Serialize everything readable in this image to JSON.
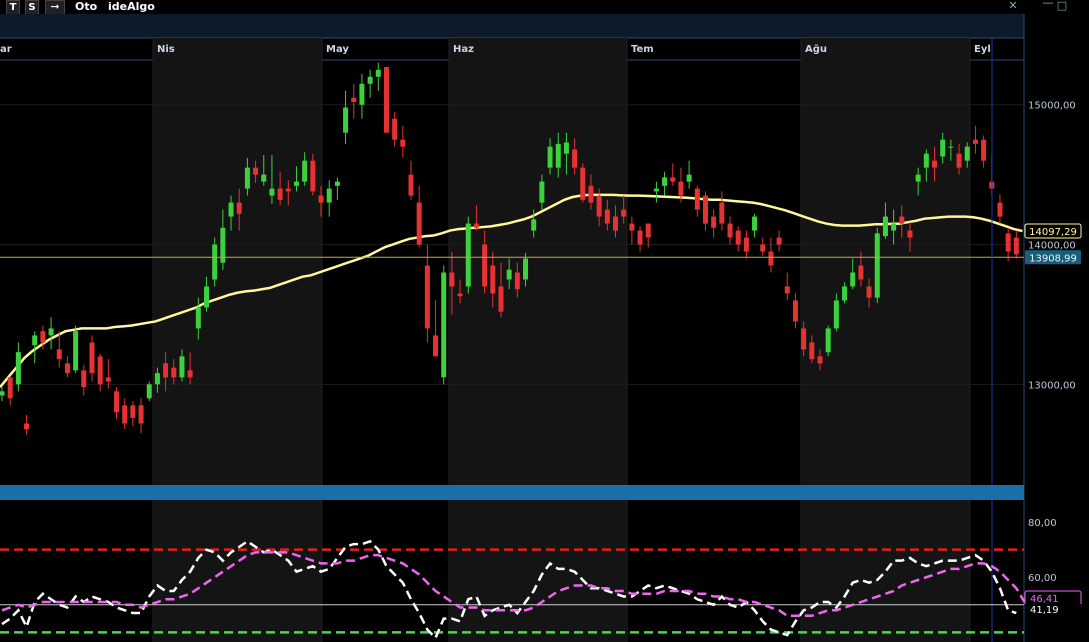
{
  "toolbar": {
    "btn_t": "T",
    "btn_s": "S",
    "arrow_icon": "arrow-right-icon",
    "oto": "Oto",
    "idealgo": "ideAlgo"
  },
  "window_controls": {
    "close": "✕",
    "minimize": "—",
    "maximize": "□"
  },
  "colors": {
    "up": "#3ed13e",
    "down": "#e63232",
    "ma": "#fff79a",
    "rsi": "#ffffff",
    "signal": "#ee66ee",
    "level_high": "#e02020",
    "level_low": "#44dd44",
    "separator": "#1a6fa8",
    "price_line": "#c8a64a",
    "label_ma_bg": "#000000",
    "label_price_bg": "#1a5f7a"
  },
  "chart_data": {
    "type": "candlestick",
    "months": [
      "ar",
      "Nis",
      "May",
      "Haz",
      "Tem",
      "Ağu",
      "Eyl"
    ],
    "y_ticks": [
      "15000,00",
      "14000,00",
      "13000,00"
    ],
    "y_values": [
      15000,
      14000,
      13000
    ],
    "price_range": [
      12280,
      15320
    ],
    "ma_label": "14097,29",
    "ma_value": 14097.29,
    "price_label": "13908,99",
    "price_value": 13908.99,
    "indicator": {
      "range": [
        36.5,
        88
      ],
      "ticks": [
        "80,00",
        "60,00"
      ],
      "tick_values": [
        80,
        60
      ],
      "level_high": 70,
      "level_low": 40,
      "mid_level": 50,
      "last_rsi_label": "41,19",
      "last_signal_label": "46,41"
    },
    "candles": [
      [
        12920,
        12980,
        12880,
        12950
      ],
      [
        13050,
        13030,
        12850,
        12900
      ],
      [
        13000,
        13300,
        12950,
        13230
      ],
      [
        12720,
        12780,
        12640,
        12680
      ],
      [
        13280,
        13380,
        13150,
        13350
      ],
      [
        13380,
        13420,
        13250,
        13300
      ],
      [
        13350,
        13480,
        13250,
        13400
      ],
      [
        13250,
        13380,
        13120,
        13180
      ],
      [
        13150,
        13200,
        13050,
        13080
      ],
      [
        13100,
        13420,
        13080,
        13380
      ],
      [
        13100,
        13140,
        12920,
        12980
      ],
      [
        13300,
        13350,
        13020,
        13080
      ],
      [
        13200,
        13220,
        12950,
        13000
      ],
      [
        13050,
        13180,
        12970,
        13020
      ],
      [
        12950,
        12980,
        12750,
        12800
      ],
      [
        12850,
        12900,
        12680,
        12720
      ],
      [
        12850,
        12880,
        12700,
        12760
      ],
      [
        12850,
        12900,
        12650,
        12720
      ],
      [
        12900,
        13020,
        12880,
        13000
      ],
      [
        13000,
        13120,
        12940,
        13080
      ],
      [
        13150,
        13230,
        12950,
        13050
      ],
      [
        13120,
        13180,
        13000,
        13050
      ],
      [
        13050,
        13250,
        13020,
        13200
      ],
      [
        13100,
        13230,
        13000,
        13050
      ],
      [
        13400,
        13620,
        13320,
        13550
      ],
      [
        13550,
        13770,
        13520,
        13700
      ],
      [
        13750,
        14050,
        13700,
        14000
      ],
      [
        13870,
        14250,
        13820,
        14120
      ],
      [
        14200,
        14350,
        14100,
        14300
      ],
      [
        14300,
        14400,
        14100,
        14220
      ],
      [
        14400,
        14620,
        14350,
        14550
      ],
      [
        14550,
        14600,
        14440,
        14500
      ],
      [
        14450,
        14640,
        14420,
        14500
      ],
      [
        14350,
        14640,
        14290,
        14400
      ],
      [
        14400,
        14520,
        14280,
        14320
      ],
      [
        14400,
        14460,
        14280,
        14380
      ],
      [
        14420,
        14560,
        14380,
        14450
      ],
      [
        14450,
        14660,
        14420,
        14600
      ],
      [
        14600,
        14650,
        14350,
        14380
      ],
      [
        14350,
        14420,
        14200,
        14300
      ],
      [
        14300,
        14460,
        14200,
        14400
      ],
      [
        14420,
        14480,
        14320,
        14450
      ],
      [
        14800,
        15100,
        14720,
        14980
      ],
      [
        15050,
        15150,
        14900,
        15020
      ],
      [
        15000,
        15220,
        14900,
        15150
      ],
      [
        15150,
        15250,
        15050,
        15200
      ],
      [
        15200,
        15300,
        15100,
        15250
      ],
      [
        15270,
        15200,
        14950,
        14800
      ],
      [
        14900,
        14950,
        14700,
        14750
      ],
      [
        14750,
        14850,
        14620,
        14700
      ],
      [
        14500,
        14600,
        14320,
        14350
      ],
      [
        14300,
        14420,
        13980,
        14000
      ],
      [
        13850,
        14000,
        13300,
        13400
      ],
      [
        13350,
        13600,
        13200,
        13200
      ],
      [
        13050,
        13850,
        13000,
        13800
      ],
      [
        13800,
        13950,
        13500,
        13700
      ],
      [
        13650,
        13750,
        13580,
        13630
      ],
      [
        13700,
        14200,
        13650,
        14150
      ],
      [
        14150,
        14280,
        14100,
        14120
      ],
      [
        14000,
        14100,
        13650,
        13700
      ],
      [
        13850,
        13950,
        13550,
        13650
      ],
      [
        13700,
        13870,
        13480,
        13520
      ],
      [
        13750,
        13900,
        13680,
        13820
      ],
      [
        13800,
        13870,
        13620,
        13680
      ],
      [
        13750,
        13940,
        13700,
        13900
      ],
      [
        14100,
        14250,
        14050,
        14180
      ],
      [
        14300,
        14500,
        14250,
        14450
      ],
      [
        14550,
        14760,
        14500,
        14700
      ],
      [
        14550,
        14800,
        14480,
        14720
      ],
      [
        14650,
        14800,
        14500,
        14730
      ],
      [
        14680,
        14760,
        14500,
        14550
      ],
      [
        14550,
        14580,
        14300,
        14320
      ],
      [
        14420,
        14500,
        14250,
        14300
      ],
      [
        14350,
        14400,
        14130,
        14200
      ],
      [
        14250,
        14320,
        14100,
        14150
      ],
      [
        14200,
        14280,
        14050,
        14100
      ],
      [
        14250,
        14350,
        14150,
        14200
      ],
      [
        14150,
        14200,
        14000,
        14100
      ],
      [
        14100,
        14130,
        13950,
        14000
      ],
      [
        14150,
        14150,
        13980,
        14050
      ],
      [
        14380,
        14450,
        14300,
        14400
      ],
      [
        14420,
        14520,
        14350,
        14480
      ],
      [
        14480,
        14580,
        14420,
        14450
      ],
      [
        14450,
        14550,
        14300,
        14350
      ],
      [
        14450,
        14600,
        14400,
        14500
      ],
      [
        14400,
        14420,
        14200,
        14250
      ],
      [
        14350,
        14380,
        14100,
        14150
      ],
      [
        14200,
        14250,
        14050,
        14120
      ],
      [
        14300,
        14380,
        14100,
        14150
      ],
      [
        14150,
        14200,
        14000,
        14050
      ],
      [
        14100,
        14130,
        13950,
        14000
      ],
      [
        14050,
        14100,
        13900,
        13950
      ],
      [
        14100,
        14220,
        14050,
        14200
      ],
      [
        14000,
        14050,
        13920,
        13950
      ],
      [
        13950,
        14050,
        13800,
        13850
      ],
      [
        14050,
        14100,
        13950,
        14000
      ],
      [
        13700,
        13800,
        13600,
        13650
      ],
      [
        13600,
        13650,
        13400,
        13450
      ],
      [
        13400,
        13450,
        13200,
        13250
      ],
      [
        13300,
        13350,
        13150,
        13180
      ],
      [
        13200,
        13250,
        13100,
        13150
      ],
      [
        13230,
        13420,
        13200,
        13400
      ],
      [
        13400,
        13650,
        13380,
        13600
      ],
      [
        13600,
        13730,
        13580,
        13700
      ],
      [
        13700,
        13900,
        13680,
        13800
      ],
      [
        13850,
        13950,
        13700,
        13750
      ],
      [
        13700,
        13760,
        13550,
        13620
      ],
      [
        13620,
        14120,
        13580,
        14080
      ],
      [
        14060,
        14300,
        14040,
        14200
      ],
      [
        14100,
        14250,
        14000,
        14150
      ],
      [
        14200,
        14280,
        14050,
        14150
      ],
      [
        14100,
        14160,
        13950,
        14050
      ],
      [
        14450,
        14550,
        14350,
        14500
      ],
      [
        14550,
        14680,
        14450,
        14650
      ],
      [
        14600,
        14700,
        14450,
        14550
      ],
      [
        14630,
        14800,
        14580,
        14750
      ],
      [
        14700,
        14750,
        14600,
        14700
      ],
      [
        14650,
        14720,
        14500,
        14550
      ],
      [
        14600,
        14730,
        14550,
        14700
      ],
      [
        14750,
        14850,
        14650,
        14720
      ],
      [
        14750,
        14780,
        14550,
        14600
      ],
      [
        14450,
        14650,
        14350,
        14400
      ],
      [
        14300,
        14360,
        14150,
        14200
      ],
      [
        14080,
        14120,
        13880,
        13950
      ],
      [
        14050,
        14100,
        13900,
        13930
      ]
    ],
    "ma": [
      12980,
      13050,
      13120,
      13190,
      13240,
      13280,
      13320,
      13350,
      13380,
      13390,
      13400,
      13400,
      13400,
      13400,
      13410,
      13415,
      13420,
      13430,
      13440,
      13450,
      13470,
      13490,
      13510,
      13530,
      13550,
      13580,
      13600,
      13620,
      13640,
      13655,
      13665,
      13670,
      13680,
      13690,
      13710,
      13730,
      13750,
      13770,
      13780,
      13800,
      13820,
      13840,
      13860,
      13880,
      13900,
      13920,
      13950,
      13980,
      14000,
      14020,
      14040,
      14050,
      14060,
      14065,
      14080,
      14100,
      14110,
      14115,
      14120,
      14125,
      14130,
      14140,
      14150,
      14165,
      14180,
      14200,
      14230,
      14260,
      14290,
      14320,
      14340,
      14350,
      14355,
      14355,
      14355,
      14355,
      14352,
      14350,
      14350,
      14348,
      14345,
      14343,
      14340,
      14337,
      14335,
      14330,
      14325,
      14320,
      14320,
      14315,
      14310,
      14305,
      14300,
      14290,
      14275,
      14260,
      14245,
      14225,
      14205,
      14185,
      14165,
      14150,
      14140,
      14135,
      14135,
      14135,
      14140,
      14145,
      14145,
      14148,
      14150,
      14160,
      14170,
      14185,
      14190,
      14195,
      14200,
      14200,
      14200,
      14195,
      14185,
      14170,
      14150,
      14130,
      14110,
      14097
    ],
    "rsi": [
      43,
      45,
      48,
      42,
      51,
      54,
      52,
      50,
      49,
      53,
      51,
      53,
      52,
      51,
      49,
      48,
      47,
      47,
      53,
      57,
      55,
      55,
      59,
      62,
      67,
      70,
      69,
      66,
      69,
      71,
      73,
      71,
      69,
      70,
      68,
      66,
      62,
      63,
      64,
      62,
      63,
      67,
      71,
      72,
      72,
      73,
      70,
      64,
      61,
      58,
      52,
      47,
      41,
      38,
      45,
      45,
      44,
      52,
      53,
      46,
      48,
      49,
      50,
      47,
      51,
      55,
      61,
      65,
      63,
      63,
      62,
      59,
      56,
      56,
      55,
      54,
      53,
      53,
      55,
      57,
      56,
      57,
      56,
      55,
      54,
      52,
      51,
      50,
      53,
      50,
      49,
      51,
      48,
      44,
      41,
      40,
      39,
      44,
      48,
      49,
      51,
      51,
      49,
      53,
      58,
      59,
      58,
      59,
      62,
      66,
      66,
      67,
      65,
      64,
      65,
      66,
      66,
      66,
      67,
      68,
      66,
      62,
      56,
      48,
      47
    ],
    "signal": [
      48,
      49,
      50,
      49,
      50,
      51,
      51,
      51,
      51,
      51,
      51,
      51,
      51,
      51,
      51,
      50,
      50,
      49,
      50,
      51,
      52,
      52,
      53,
      54,
      56,
      58,
      60,
      62,
      64,
      66,
      68,
      69,
      69,
      69,
      69,
      69,
      68,
      67,
      66,
      65,
      65,
      65,
      66,
      66,
      67,
      68,
      68,
      67,
      66,
      65,
      63,
      61,
      58,
      55,
      53,
      51,
      49,
      49,
      49,
      48,
      48,
      48,
      48,
      48,
      48,
      49,
      51,
      53,
      55,
      56,
      57,
      57,
      57,
      56,
      56,
      55,
      55,
      54,
      54,
      54,
      54,
      55,
      55,
      55,
      55,
      54,
      54,
      53,
      53,
      52,
      52,
      51,
      51,
      50,
      49,
      48,
      46,
      46,
      46,
      46,
      47,
      48,
      48,
      49,
      50,
      51,
      52,
      53,
      54,
      55,
      57,
      58,
      59,
      60,
      61,
      62,
      63,
      63,
      64,
      65,
      65,
      64,
      62,
      59,
      56,
      51
    ]
  }
}
